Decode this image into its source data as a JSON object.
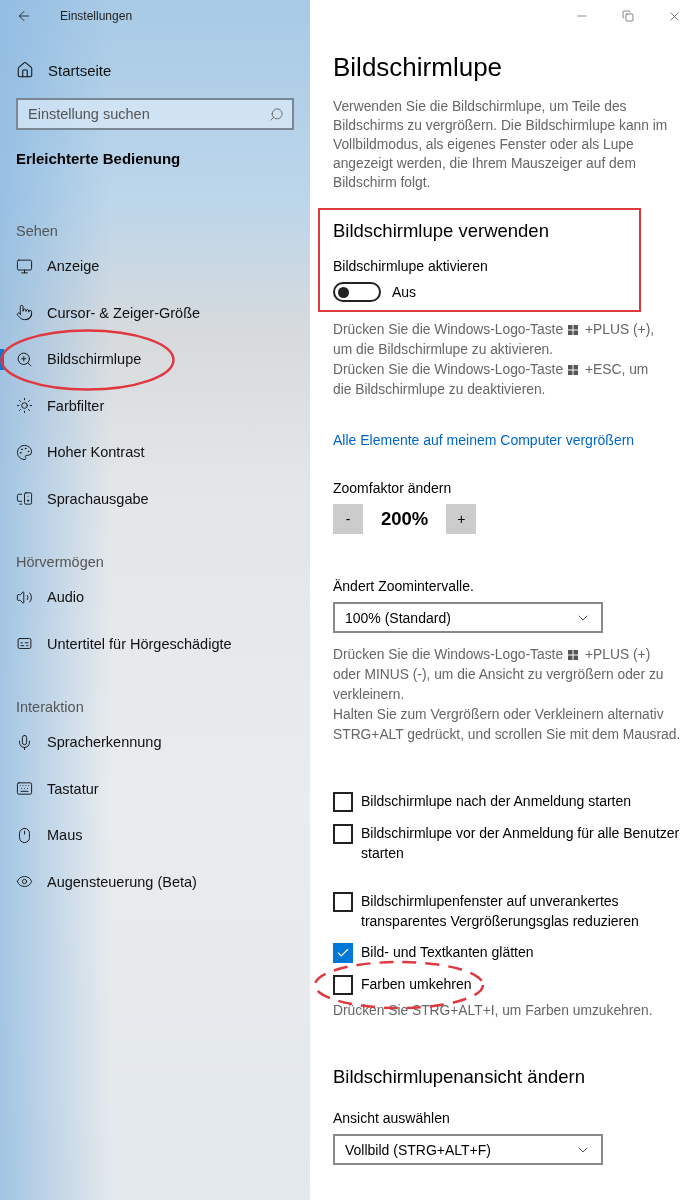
{
  "window": {
    "title": "Einstellungen"
  },
  "sidebar": {
    "home": "Startseite",
    "search": {
      "placeholder": "Einstellung suchen"
    },
    "category": "Erleichterte Bedienung",
    "groups": [
      {
        "heading": "Sehen",
        "items": [
          {
            "label": "Anzeige",
            "selected": false
          },
          {
            "label": "Cursor- & Zeiger-Größe",
            "selected": false
          },
          {
            "label": "Bildschirmlupe",
            "selected": true,
            "circled": true
          },
          {
            "label": "Farbfilter",
            "selected": false
          },
          {
            "label": "Hoher Kontrast",
            "selected": false
          },
          {
            "label": "Sprachausgabe",
            "selected": false
          }
        ]
      },
      {
        "heading": "Hörvermögen",
        "items": [
          {
            "label": "Audio",
            "selected": false
          },
          {
            "label": "Untertitel für Hörgeschädigte",
            "selected": false
          }
        ]
      },
      {
        "heading": "Interaktion",
        "items": [
          {
            "label": "Spracherkennung",
            "selected": false
          },
          {
            "label": "Tastatur",
            "selected": false
          },
          {
            "label": "Maus",
            "selected": false
          },
          {
            "label": "Augensteuerung (Beta)",
            "selected": false
          }
        ]
      }
    ]
  },
  "page": {
    "title": "Bildschirmlupe",
    "intro": "Verwenden Sie die Bildschirmlupe, um Teile des Bildschirms zu vergrößern. Die Bildschirmlupe kann im Vollbildmodus, als eigenes Fenster oder als Lupe angezeigt werden, die Ihrem Mauszeiger auf dem Bildschirm folgt.",
    "use_section": {
      "heading": "Bildschirmlupe verwenden",
      "framed": true,
      "toggle": {
        "label": "Bildschirmlupe aktivieren",
        "on": false,
        "state_label": "Aus"
      }
    },
    "use_help": [
      {
        "before": "Drücken Sie die Windows-Logo-Taste",
        "after": "+PLUS (+),",
        "rest": "um die Bildschirmlupe zu aktivieren."
      },
      {
        "before": "Drücken Sie die Windows-Logo-Taste",
        "after": "+ESC, um",
        "rest": "die Bildschirmlupe zu deaktivieren."
      }
    ],
    "link": "Alle Elemente auf meinem Computer vergrößern",
    "zoom": {
      "label": "Zoomfaktor ändern",
      "minus": "-",
      "value": "200%",
      "plus": "+"
    },
    "interval": {
      "label": "Ändert Zoomintervalle.",
      "value": "100% (Standard)"
    },
    "interval_help": [
      {
        "before": "Drücken Sie die Windows-Logo-Taste",
        "after": "+PLUS (+)",
        "rest": "oder MINUS (-), um die Ansicht zu vergrößern oder zu verkleinern."
      },
      {
        "before": "Halten Sie zum Vergrößern oder Verkleinern alternativ STRG+ALT gedrückt, und scrollen Sie mit dem Mausrad."
      }
    ],
    "option_groups": [
      [
        {
          "label": "Bildschirmlupe nach der Anmeldung starten",
          "checked": false
        },
        {
          "label": "Bildschirmlupe vor der Anmeldung für alle Benutzer starten",
          "checked": false
        }
      ],
      [
        {
          "label": "Bildschirmlupenfenster auf unverankertes transparentes Vergrößerungsglas reduzieren",
          "checked": false
        },
        {
          "label": "Bild- und Textkanten glätten",
          "checked": true
        },
        {
          "label": "Farben umkehren",
          "checked": false,
          "circled_dashed": true,
          "note": "Drücken Sie STRG+ALT+I, um Farben umzukehren."
        }
      ]
    ],
    "view_section": {
      "heading": "Bildschirmlupenansicht ändern",
      "label": "Ansicht auswählen",
      "value": "Vollbild (STRG+ALT+F)"
    }
  }
}
